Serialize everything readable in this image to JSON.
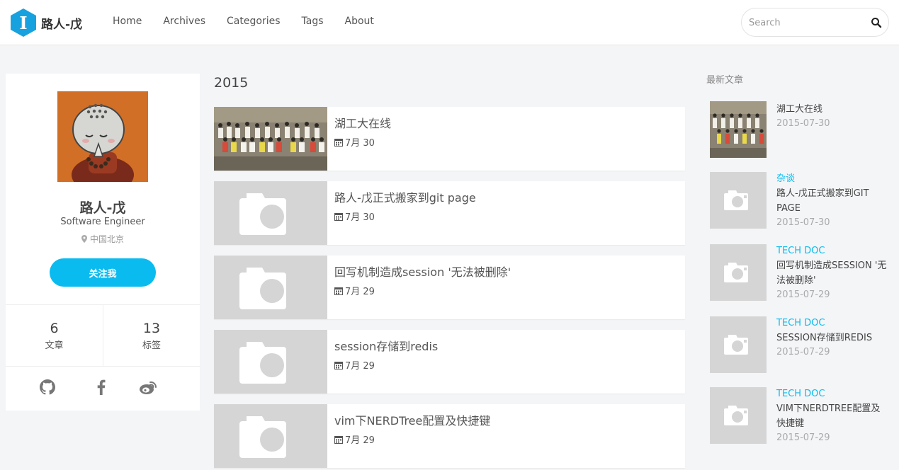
{
  "site": {
    "logo_letter": "I",
    "title": "路人-戊",
    "brand_color": "#17a2df"
  },
  "nav": {
    "items": [
      {
        "label": "Home"
      },
      {
        "label": "Archives"
      },
      {
        "label": "Categories"
      },
      {
        "label": "Tags"
      },
      {
        "label": "About"
      }
    ]
  },
  "search": {
    "placeholder": "Search",
    "icon": "search-icon"
  },
  "profile": {
    "name": "路人-戊",
    "job": "Software Engineer",
    "location": "中国北京",
    "follow_label": "关注我",
    "accent_color": "#0abbef",
    "stats": [
      {
        "value": "6",
        "label": "文章"
      },
      {
        "value": "13",
        "label": "标签"
      }
    ],
    "social": [
      "github-icon",
      "facebook-icon",
      "weibo-icon"
    ]
  },
  "archive": {
    "year": "2015",
    "posts": [
      {
        "title": "湖工大在线",
        "date": "7月 30",
        "thumb": "group-photo"
      },
      {
        "title": "路人-戊正式搬家到git page",
        "date": "7月 30",
        "thumb": "camera-placeholder"
      },
      {
        "title": "回写机制造成session '无法被删除'",
        "date": "7月 29",
        "thumb": "camera-placeholder"
      },
      {
        "title": "session存储到redis",
        "date": "7月 29",
        "thumb": "camera-placeholder"
      },
      {
        "title": "vim下NERDTree配置及快捷键",
        "date": "7月 29",
        "thumb": "camera-placeholder"
      }
    ]
  },
  "sidebar": {
    "recent_title": "最新文章",
    "recent": [
      {
        "category": "",
        "title": "湖工大在线",
        "date": "2015-07-30",
        "thumb": "group-photo"
      },
      {
        "category": "杂谈",
        "title": "路人-戊正式搬家到GIT PAGE",
        "date": "2015-07-30",
        "thumb": "camera-placeholder"
      },
      {
        "category": "TECH DOC",
        "title": "回写机制造成SESSION '无法被删除'",
        "date": "2015-07-29",
        "thumb": "camera-placeholder"
      },
      {
        "category": "TECH DOC",
        "title": "SESSION存储到REDIS",
        "date": "2015-07-29",
        "thumb": "camera-placeholder"
      },
      {
        "category": "TECH DOC",
        "title": "VIM下NERDTREE配置及快捷键",
        "date": "2015-07-29",
        "thumb": "camera-placeholder"
      }
    ]
  }
}
